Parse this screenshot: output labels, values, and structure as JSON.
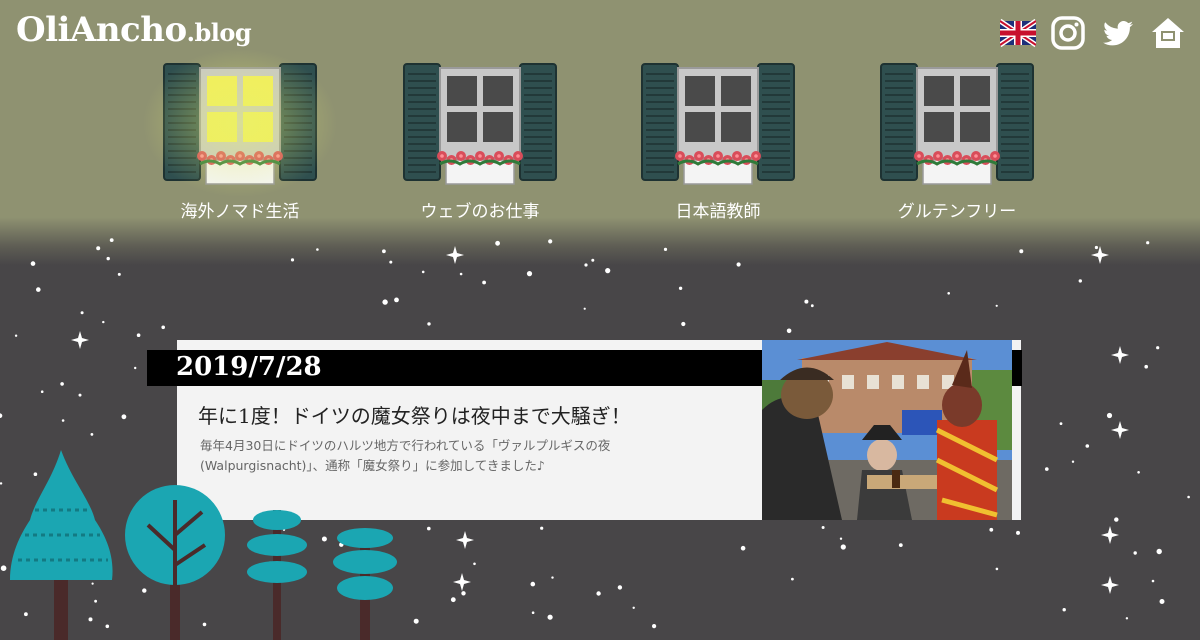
{
  "brand": {
    "name": "OliAncho",
    "suffix": ".blog"
  },
  "header_icons": [
    "uk-flag-icon",
    "instagram-icon",
    "twitter-icon",
    "home-icon"
  ],
  "nav": [
    {
      "label": "海外ノマド生活",
      "lit": true
    },
    {
      "label": "ウェブのお仕事",
      "lit": false
    },
    {
      "label": "日本語教師",
      "lit": false
    },
    {
      "label": "グルテンフリー",
      "lit": false
    }
  ],
  "post": {
    "date": "2019/7/28",
    "title": "年に1度！ドイツの魔女祭りは夜中まで大騒ぎ！",
    "excerpt": "毎年4月30日にドイツのハルツ地方で行われている「ヴァルプルギスの夜(Walpurgisnacht)」、通称「魔女祭り」に参加してきました♪"
  },
  "colors": {
    "wall": "#8f9271",
    "night": "#484648",
    "shutter": "#2f4f4f",
    "lit_glass": "#f3ef5a",
    "tree": "#1ba6b2"
  }
}
